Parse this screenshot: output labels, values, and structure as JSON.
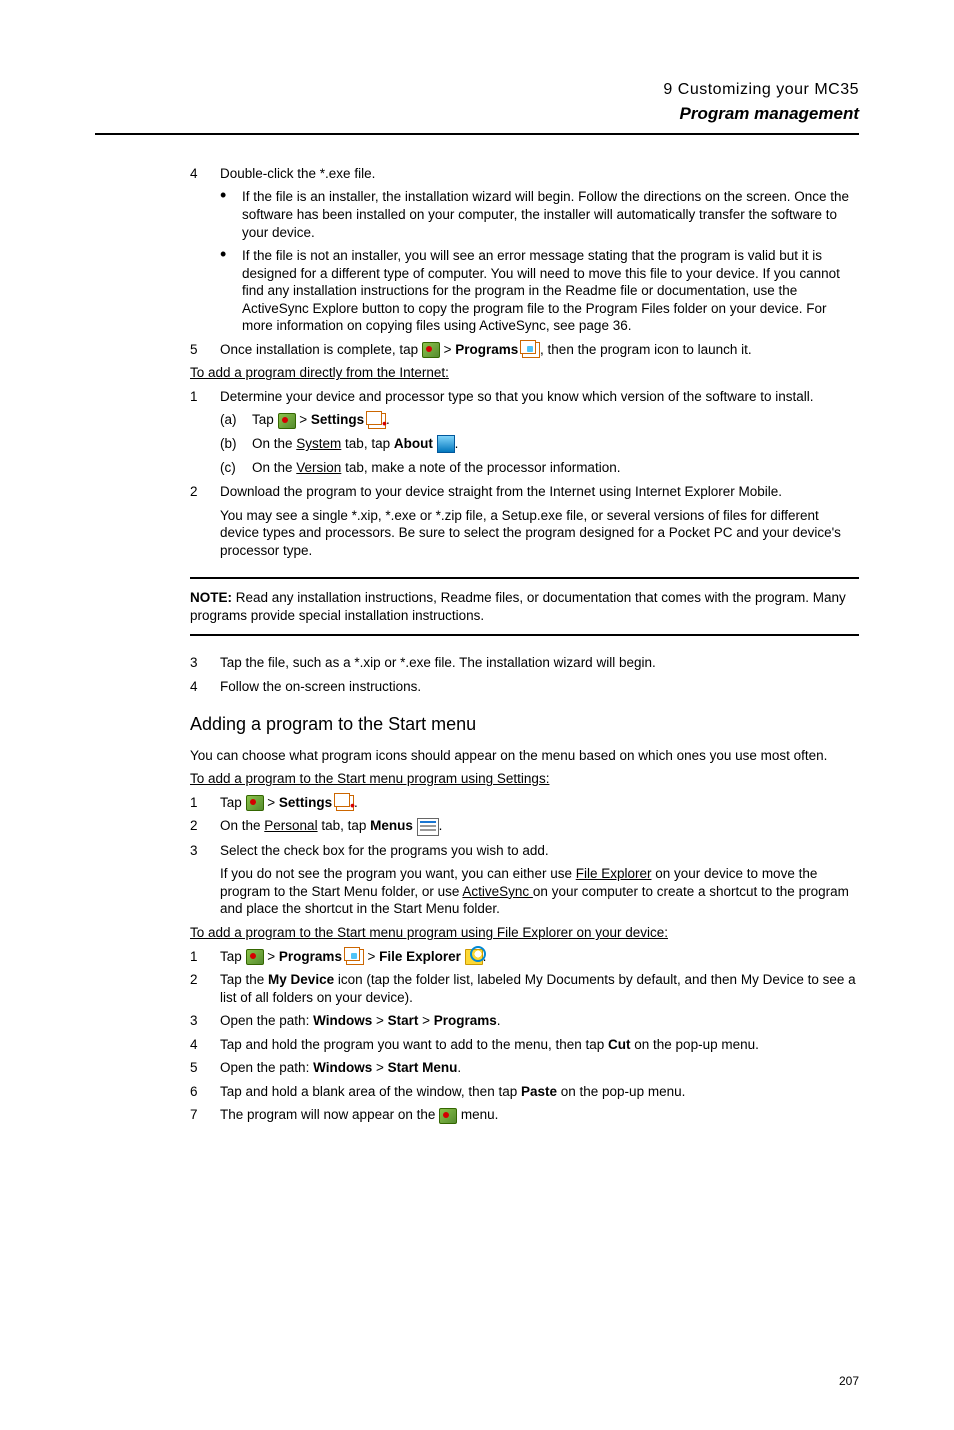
{
  "header": {
    "chapter": "9 Customizing your MC35",
    "section": "Program management"
  },
  "s4": {
    "num": "4",
    "text": "Double-click the *.exe file."
  },
  "b1": "If the file is an installer, the installation wizard will begin. Follow the directions on the screen. Once the software has been installed on your computer, the installer will automatically transfer the software to your device.",
  "b2": "If the file is not an installer, you will see an error message stating that the program is valid but it is designed for a different type of computer. You will need to move this file to your device. If you cannot find any installation instructions for the program in the Readme file or documentation, use the ActiveSync Explore button to copy the program file to the Program Files folder on your device. For more information on copying files using ActiveSync, see page 36.",
  "s5": {
    "num": "5",
    "pre": "Once installation is complete, tap ",
    "mid1": " > ",
    "programs": "Programs",
    "mid2": " ",
    "post": ", then the program icon to launch it."
  },
  "internet_head": "To add a program directly from the Internet:",
  "i1": {
    "num": "1",
    "text": "Determine your device and processor type so that you know which version of the software to install."
  },
  "ia": {
    "lbl": "(a)",
    "pre": "Tap ",
    "mid": " > ",
    "settings": "Settings",
    "end": "."
  },
  "ib": {
    "lbl": "(b)",
    "pre": "On the ",
    "tab": "System",
    "mid": " tab, tap ",
    "about": "About",
    "end": "."
  },
  "ic": {
    "lbl": "(c)",
    "pre": "On the ",
    "tab": "Version",
    "post": " tab, make a note of the processor information."
  },
  "i2": {
    "num": "2",
    "text": "Download the program to your device straight from the Internet using Internet Explorer Mobile.",
    "sub": "You may see a single *.xip,  *.exe or *.zip file, a Setup.exe file, or several versions of files for different device types and processors. Be sure to select the program designed for a Pocket PC and your device's processor type."
  },
  "note": {
    "label": "NOTE:",
    "text": "   Read any installation instructions, Readme files, or documentation that comes with the program. Many programs provide special installation instructions."
  },
  "i3": {
    "num": "3",
    "text": "Tap the file, such as a *.xip or *.exe file. The installation wizard will begin."
  },
  "i4": {
    "num": "4",
    "text": "Follow the on-screen instructions."
  },
  "add_head": "Adding a program to the Start menu",
  "add_intro": "You can choose what program icons should appear on the menu based on which ones you use most often.",
  "add_sub1": "To add a program to the Start menu program using Settings:",
  "a1": {
    "num": "1",
    "pre": "Tap ",
    "mid": " > ",
    "settings": "Settings",
    "end": "."
  },
  "a2": {
    "num": "2",
    "pre": "On the ",
    "tab": "Personal",
    "mid": " tab, tap ",
    "menus": "Menus",
    "end": "."
  },
  "a3": {
    "num": "3",
    "text": "Select the check box for the programs you wish to add.",
    "sub_pre": "If you do not see the program you want, you can either use ",
    "link1": "File Explorer",
    "sub_mid": " on your device to move the program to the Start Menu folder, or use ",
    "link2": "ActiveSync ",
    "sub_post": "on your computer to create a shortcut to the program and place the shortcut in the Start Menu folder."
  },
  "add_sub2": "To add a program to the Start menu program using File Explorer on your device:",
  "f1": {
    "num": "1",
    "pre": "Tap ",
    "g1": " > ",
    "programs": "Programs",
    "g2": " ",
    "g3": " > ",
    "fe": "File Explorer",
    "end": "."
  },
  "f2": {
    "num": "2",
    "pre": "Tap the ",
    "md": "My Device",
    "post": " icon (tap the folder list, labeled My Documents by default, and then My Device to see a list of all folders on your device)."
  },
  "f3": {
    "num": "3",
    "pre": "Open the path: ",
    "w": "Windows",
    "g1": " > ",
    "s": "Start",
    "g2": " > ",
    "p": "Programs",
    "end": "."
  },
  "f4": {
    "num": "4",
    "pre": "Tap and hold the program you want to add to the menu, then tap ",
    "cut": "Cut",
    "post": " on the pop-up menu."
  },
  "f5": {
    "num": "5",
    "pre": "Open the path: ",
    "w": "Windows",
    "g": " > ",
    "sm": "Start Menu",
    "end": "."
  },
  "f6": {
    "num": "6",
    "pre": "Tap and hold a blank area of the window, then tap ",
    "paste": "Paste",
    "post": " on the pop-up menu."
  },
  "f7": {
    "num": "7",
    "pre": "The program will now appear on the ",
    "post": " menu."
  },
  "pagenum": "207"
}
